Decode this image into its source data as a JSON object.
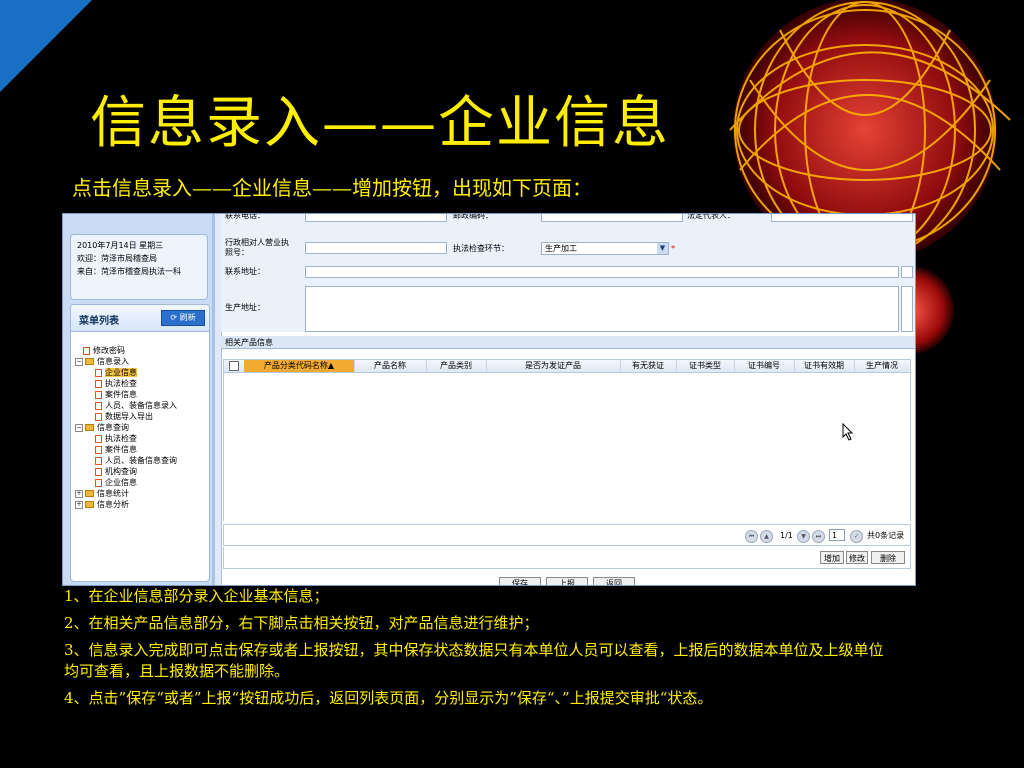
{
  "slide": {
    "title": "信息录入——企业信息",
    "subtitle": "点击信息录入——企业信息——增加按钮，出现如下页面：",
    "notes": [
      "1、在企业信息部分录入企业基本信息；",
      "2、在相关产品信息部分，右下脚点击相关按钮，对产品信息进行维护；",
      "3、信息录入完成即可点击保存或者上报按钮，其中保存状态数据只有本单位人员可以查看，上报后的数据本单位及上级单位均可查看，且上报数据不能删除。",
      "4、点击”保存“或者”上报“按钮成功后，返回列表页面，分别显示为”保存“、”上报提交审批“状态。"
    ],
    "accent_color": "#ffee00",
    "corner_color": "#1a6fc4"
  },
  "app": {
    "info": {
      "date": "2010年7月14日 星期三",
      "welcome": "欢迎：菏泽市局稽查局",
      "from": "来自：菏泽市稽查局执法一科"
    },
    "menu": {
      "title": "菜单列表",
      "refresh_label": "刷新",
      "items": [
        {
          "label": "修改密码"
        },
        {
          "label": "信息录入"
        },
        {
          "label": "企业信息"
        },
        {
          "label": "执法检查"
        },
        {
          "label": "案件信息"
        },
        {
          "label": "人员、装备信息录入"
        },
        {
          "label": "数据导入导出"
        },
        {
          "label": "信息查询"
        },
        {
          "label": "执法检查"
        },
        {
          "label": "案件信息"
        },
        {
          "label": "人员、装备信息查询"
        },
        {
          "label": "机构查询"
        },
        {
          "label": "企业信息"
        },
        {
          "label": "信息统计"
        },
        {
          "label": "信息分析"
        }
      ]
    },
    "form": {
      "phone_label": "联系电话：",
      "zip_label": "邮政编码：",
      "legal_rep_label": "法定代表人：",
      "license_label_1": "行政相对人营业执",
      "license_label_2": "照号：",
      "inspection_label": "执法检查环节：",
      "inspection_value": "生产加工",
      "contact_addr_label": "联系地址：",
      "prod_addr_label": "生产地址："
    },
    "products": {
      "section_title": "相关产品信息",
      "columns": [
        "产品分类代码名称▲",
        "产品名称",
        "产品类别",
        "是否为发证产品",
        "有无获证",
        "证书类型",
        "证书编号",
        "证书有效期",
        "生产情况"
      ]
    },
    "pager": {
      "page_info": "1/1",
      "page_input": "1",
      "total": "共0条记录"
    },
    "actions": {
      "add": "增加",
      "edit": "修改",
      "delete": "删除"
    },
    "footer_buttons": {
      "save": "保存",
      "report": "上报",
      "back": "返回"
    }
  }
}
